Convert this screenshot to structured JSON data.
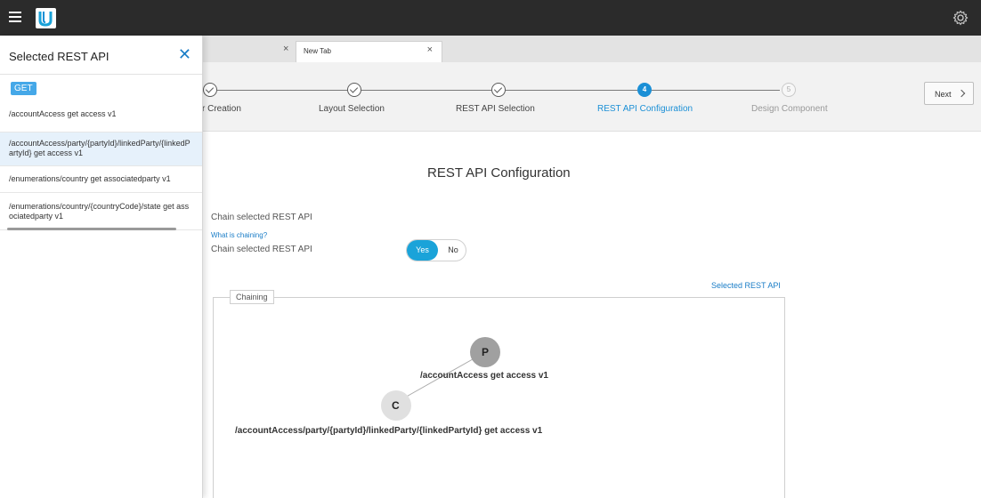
{
  "colors": {
    "topbar": "#2b2b2b",
    "accent": "#1a8fd6",
    "toggle_active": "#1aa3d9",
    "link": "#1a7dc7"
  },
  "topbar": {
    "menu_icon": "hamburger-icon",
    "logo_icon": "logo-icon",
    "settings_icon": "gear-icon"
  },
  "panel": {
    "title": "Selected REST API",
    "close_icon": "close-icon",
    "method": "GET",
    "items": [
      {
        "label": "/accountAccess get access v1"
      },
      {
        "label": "/accountAccess/party/{partyId}/linkedParty/{linkedPartyId} get access v1",
        "selected": true
      },
      {
        "label": "/enumerations/country get associatedparty v1"
      },
      {
        "label": "/enumerations/country/{countryCode}/state get associatedparty v1"
      }
    ]
  },
  "tabs": [
    {
      "label": "",
      "close": "×"
    },
    {
      "label": "New Tab",
      "close": "×"
    }
  ],
  "stepper": {
    "steps": [
      {
        "number": "1",
        "label": "r Creation",
        "state": "done"
      },
      {
        "number": "2",
        "label": "Layout Selection",
        "state": "done"
      },
      {
        "number": "3",
        "label": "REST API Selection",
        "state": "done"
      },
      {
        "number": "4",
        "label": "REST API Configuration",
        "state": "active"
      },
      {
        "number": "5",
        "label": "Design Component",
        "state": "todo"
      }
    ],
    "next_label": "Next"
  },
  "main": {
    "title": "REST API Configuration",
    "chain_heading": "Chain selected REST API",
    "chain_help": "What is chaining?",
    "chain_label": "Chain selected REST API",
    "toggle": {
      "yes": "Yes",
      "no": "No",
      "value": "Yes"
    },
    "selected_link": "Selected REST API",
    "chaining": {
      "legend": "Chaining",
      "parent": {
        "letter": "P",
        "label": "/accountAccess get access v1"
      },
      "child": {
        "letter": "C",
        "label": "/accountAccess/party/{partyId}/linkedParty/{linkedPartyId} get access v1"
      }
    }
  }
}
